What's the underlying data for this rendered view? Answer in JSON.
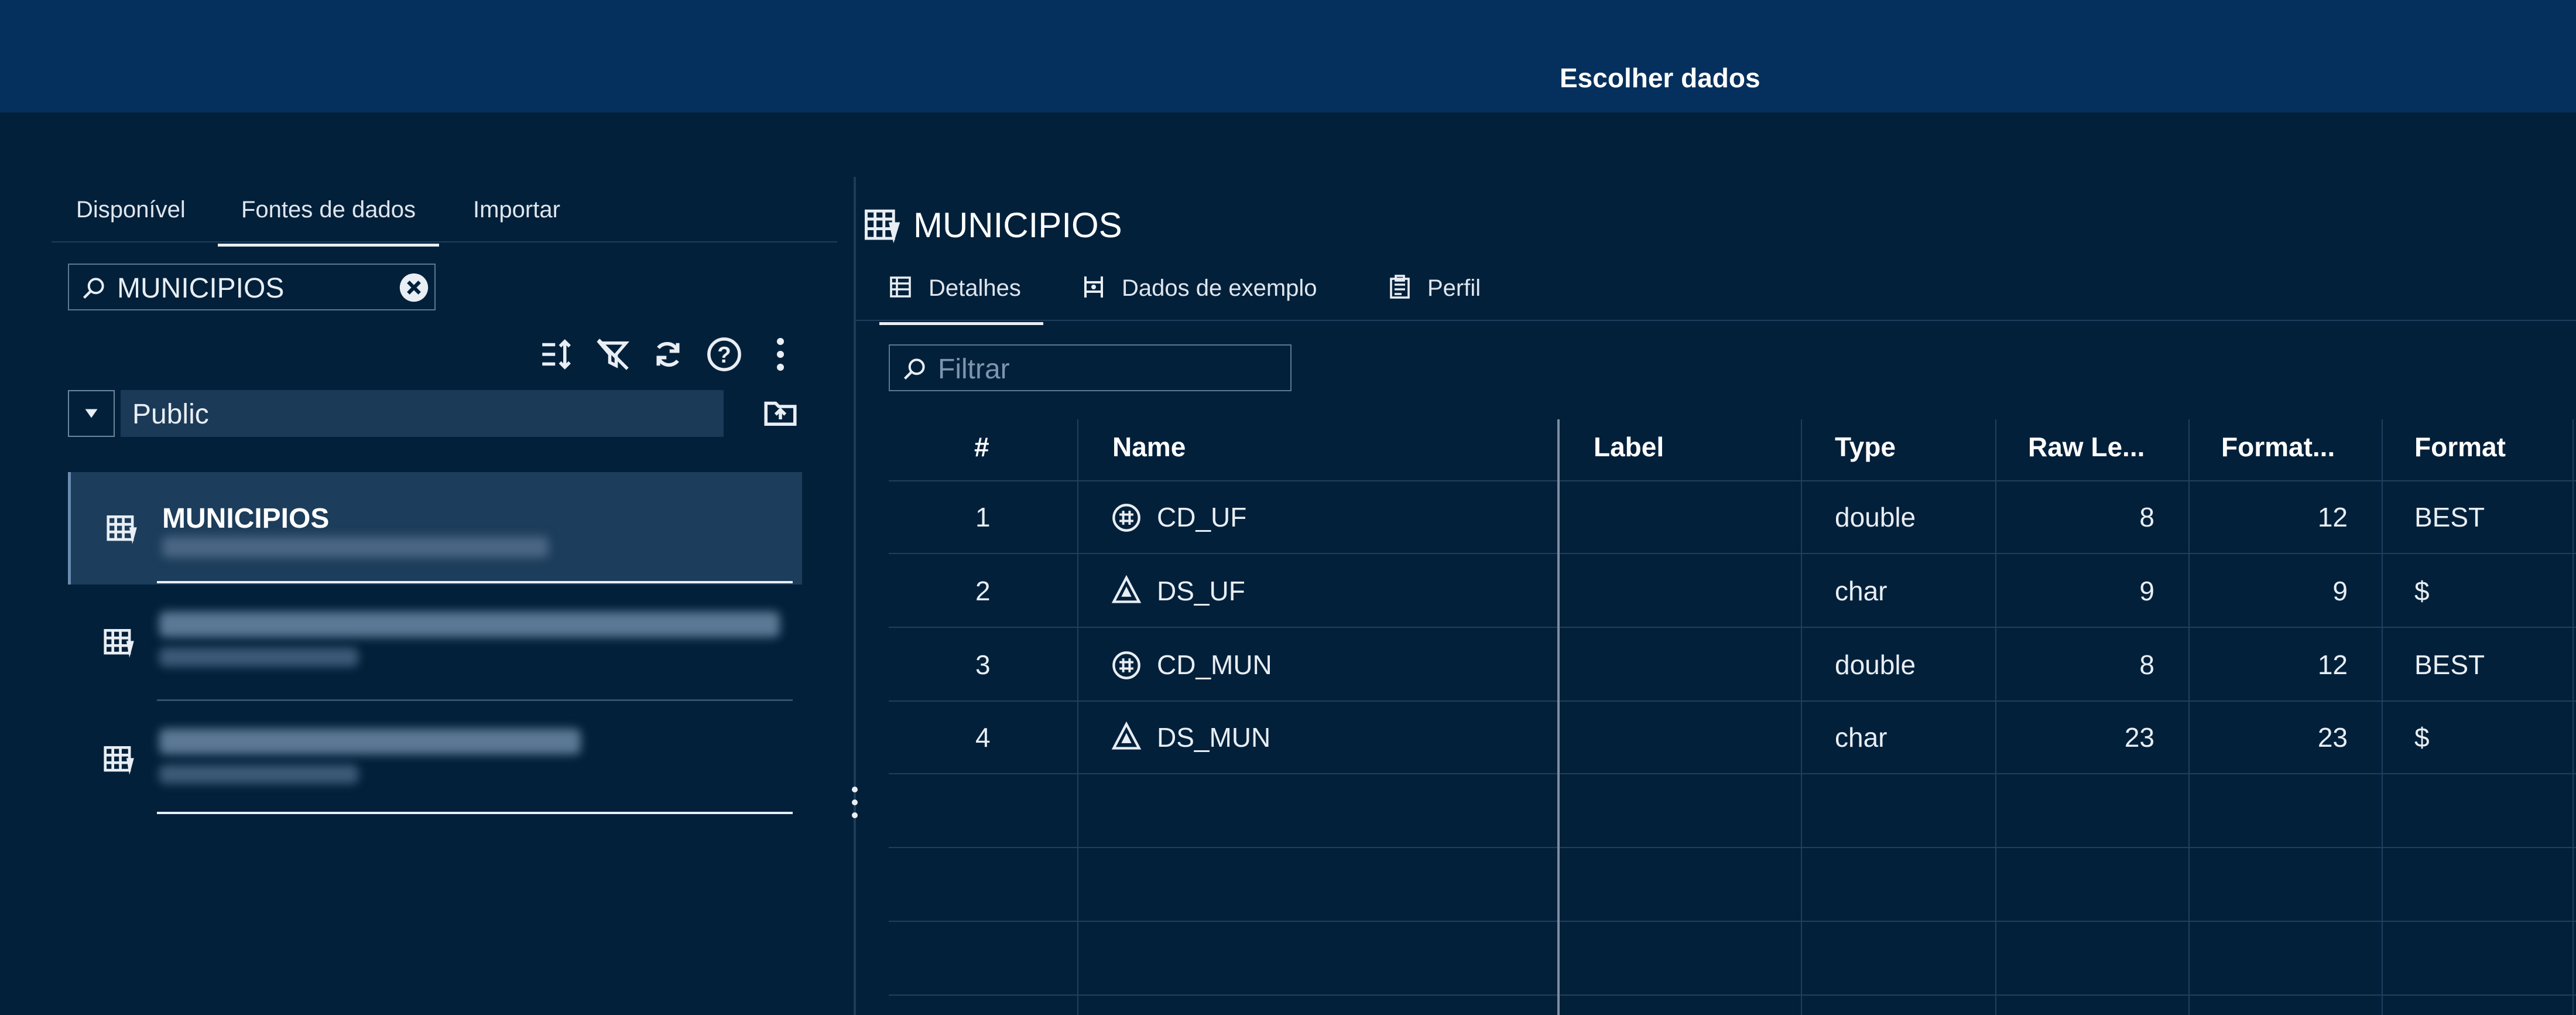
{
  "window": {
    "title": "Escolher dados"
  },
  "left_panel": {
    "tabs": [
      {
        "label": "Disponível"
      },
      {
        "label": "Fontes de dados"
      },
      {
        "label": "Importar"
      }
    ],
    "active_tab": "Fontes de dados",
    "search": {
      "value": "MUNICIPIOS"
    },
    "toolbar_icons": [
      "sort-icon",
      "filter-off-icon",
      "refresh-icon",
      "help-icon",
      "more-options-icon"
    ],
    "library": {
      "selected": "Public"
    },
    "tables": [
      {
        "name": "MUNICIPIOS",
        "selected": true
      }
    ]
  },
  "detail": {
    "table_name": "MUNICIPIOS",
    "tabs": [
      {
        "label": "Detalhes",
        "icon": "details-icon"
      },
      {
        "label": "Dados de exemplo",
        "icon": "sample-data-icon"
      },
      {
        "label": "Perfil",
        "icon": "profile-icon"
      }
    ],
    "active_tab": "Detalhes",
    "filter": {
      "placeholder": "Filtrar"
    },
    "columns_header": [
      "#",
      "Name",
      "Label",
      "Type",
      "Raw Le...",
      "Format...",
      "Format"
    ],
    "rows": [
      {
        "num": "1",
        "name": "CD_UF",
        "name_icon": "numeric-icon",
        "label": "",
        "type": "double",
        "raw_length": "8",
        "format_length": "12",
        "format": "BEST"
      },
      {
        "num": "2",
        "name": "DS_UF",
        "name_icon": "character-icon",
        "label": "",
        "type": "char",
        "raw_length": "9",
        "format_length": "9",
        "format": "$"
      },
      {
        "num": "3",
        "name": "CD_MUN",
        "name_icon": "numeric-icon",
        "label": "",
        "type": "double",
        "raw_length": "8",
        "format_length": "12",
        "format": "BEST"
      },
      {
        "num": "4",
        "name": "DS_MUN",
        "name_icon": "character-icon",
        "label": "",
        "type": "char",
        "raw_length": "23",
        "format_length": "23",
        "format": "$"
      }
    ]
  }
}
